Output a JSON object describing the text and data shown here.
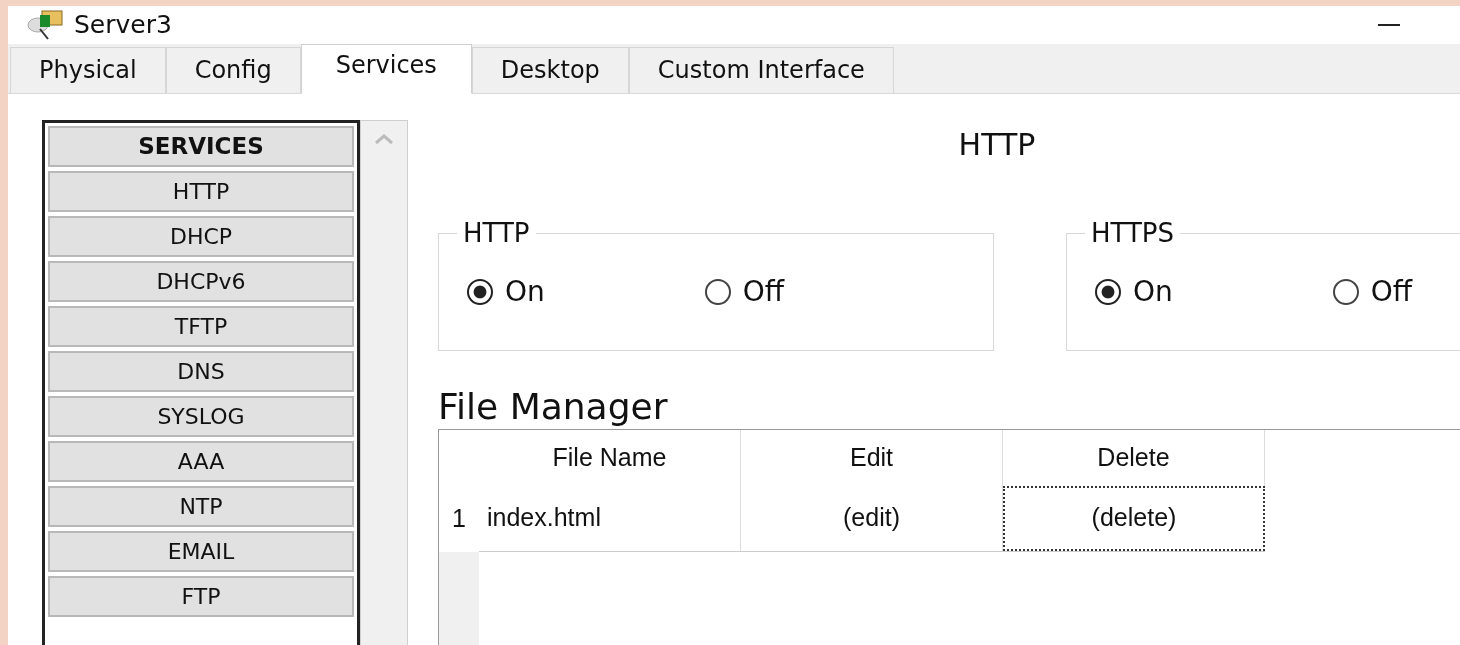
{
  "window": {
    "title": "Server3"
  },
  "tabs": [
    {
      "label": "Physical",
      "selected": false
    },
    {
      "label": "Config",
      "selected": false
    },
    {
      "label": "Services",
      "selected": true
    },
    {
      "label": "Desktop",
      "selected": false
    },
    {
      "label": "Custom Interface",
      "selected": false
    }
  ],
  "sidebar": {
    "header": "SERVICES",
    "items": [
      "HTTP",
      "DHCP",
      "DHCPv6",
      "TFTP",
      "DNS",
      "SYSLOG",
      "AAA",
      "NTP",
      "EMAIL",
      "FTP"
    ]
  },
  "panel": {
    "title": "HTTP",
    "groups": [
      {
        "title": "HTTP",
        "options": [
          {
            "label": "On",
            "selected": true
          },
          {
            "label": "Off",
            "selected": false
          }
        ]
      },
      {
        "title": "HTTPS",
        "options": [
          {
            "label": "On",
            "selected": true
          },
          {
            "label": "Off",
            "selected": false
          }
        ]
      }
    ],
    "file_manager": {
      "title": "File Manager",
      "columns": [
        "File Name",
        "Edit",
        "Delete"
      ],
      "rows": [
        {
          "number": "1",
          "cells": [
            {
              "text": "index.html",
              "focused": false
            },
            {
              "text": "(edit)",
              "focused": false
            },
            {
              "text": "(delete)",
              "focused": true
            }
          ]
        }
      ]
    }
  }
}
